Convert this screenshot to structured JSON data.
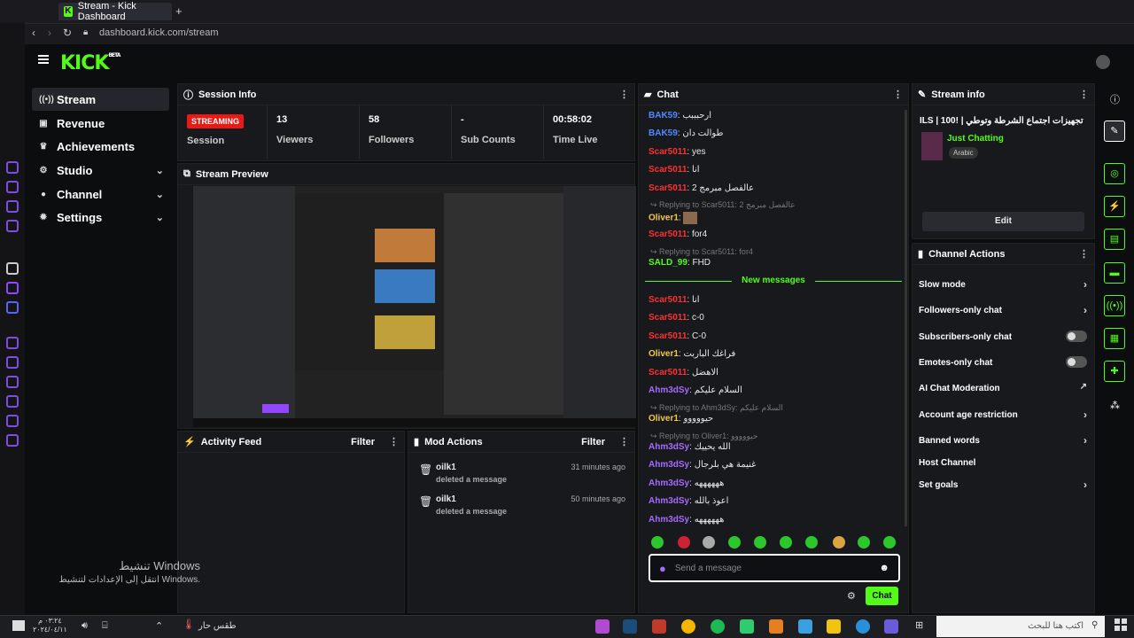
{
  "browser": {
    "tab_title": "Stream - Kick Dashboard",
    "url": "dashboard.kick.com/stream"
  },
  "app": {
    "logo": "KICK",
    "beta": "BETA"
  },
  "sidebar": {
    "items": [
      {
        "label": "Stream",
        "icon": "live-icon",
        "active": true
      },
      {
        "label": "Revenue",
        "icon": "wallet-icon"
      },
      {
        "label": "Achievements",
        "icon": "trophy-icon"
      },
      {
        "label": "Studio",
        "icon": "gear-icon",
        "expandable": true
      },
      {
        "label": "Channel",
        "icon": "user-icon",
        "expandable": true
      },
      {
        "label": "Settings",
        "icon": "settings-icon",
        "expandable": true
      }
    ]
  },
  "session": {
    "title": "Session Info",
    "badge": "STREAMING",
    "session_label": "Session",
    "stats": [
      {
        "value": "13",
        "label": "Viewers"
      },
      {
        "value": "58",
        "label": "Followers"
      },
      {
        "value": "-",
        "label": "Sub Counts"
      },
      {
        "value": "00:58:02",
        "label": "Time Live"
      }
    ]
  },
  "preview": {
    "title": "Stream Preview"
  },
  "activity": {
    "title": "Activity Feed",
    "filter": "Filter"
  },
  "mod": {
    "title": "Mod Actions",
    "filter": "Filter",
    "items": [
      {
        "user": "oilk1",
        "action": "deleted a message",
        "time": "31 minutes ago"
      },
      {
        "user": "oilk1",
        "action": "deleted a message",
        "time": "50 minutes ago"
      }
    ]
  },
  "chat": {
    "title": "Chat",
    "new_messages": "New messages",
    "placeholder": "Send a message",
    "send": "Chat",
    "messages": [
      {
        "user": "BAK59",
        "text": "ارحبببب",
        "color": "blue"
      },
      {
        "user": "BAK59",
        "text": "طوالت دان",
        "color": "blue"
      },
      {
        "user": "Scar5011",
        "text": "yes",
        "color": "red"
      },
      {
        "user": "Scar5011",
        "text": "انا",
        "color": "red"
      },
      {
        "user": "Scar5011",
        "text": "عالفصل مبرمج 2",
        "color": "red"
      },
      {
        "reply": "Replying to Scar5011: عالفصل مبرمج 2"
      },
      {
        "user": "Oliver1",
        "text": "",
        "color": "yellow"
      },
      {
        "user": "Scar5011",
        "text": "for4",
        "color": "red"
      },
      {
        "reply": "Replying to Scar5011: for4"
      },
      {
        "user": "SALD_99",
        "text": "FHD",
        "color": "green"
      },
      {
        "divider": true
      },
      {
        "user": "Scar5011",
        "text": "انا",
        "color": "red"
      },
      {
        "user": "Scar5011",
        "text": "c-0",
        "color": "red"
      },
      {
        "user": "Scar5011",
        "text": "C-0",
        "color": "red"
      },
      {
        "user": "Oliver1",
        "text": "فراغك الباربت",
        "color": "yellow"
      },
      {
        "user": "Scar5011",
        "text": "الاهضل",
        "color": "red"
      },
      {
        "user": "Ahm3dSy",
        "text": "السلام عليكم",
        "color": "purple"
      },
      {
        "reply": "Replying to Ahm3dSy: السلام عليكم"
      },
      {
        "user": "Oliver1",
        "text": "حيووووو",
        "color": "yellow"
      },
      {
        "reply": "Replying to Oliver1: حيووووو"
      },
      {
        "user": "Ahm3dSy",
        "text": "الله يحييك",
        "color": "purple"
      },
      {
        "user": "Ahm3dSy",
        "text": "غنيمة هي بلرجال",
        "color": "purple"
      },
      {
        "user": "Ahm3dSy",
        "text": "ههههههه",
        "color": "purple"
      },
      {
        "user": "Ahm3dSy",
        "text": "اعوذ بالله",
        "color": "purple"
      },
      {
        "user": "Ahm3dSy",
        "text": "ههههههه",
        "color": "purple"
      }
    ]
  },
  "stream_info": {
    "title": "Stream info",
    "stream_title": "تجهيزات اجتماع الشرطة وتوطي | !ILS | 100",
    "category": "Just Chatting",
    "tag": "Arabic",
    "edit": "Edit"
  },
  "channel_actions": {
    "title": "Channel Actions",
    "items": [
      {
        "label": "Slow mode",
        "control": "chevron"
      },
      {
        "label": "Followers-only chat",
        "control": "chevron"
      },
      {
        "label": "Subscribers-only chat",
        "control": "toggle"
      },
      {
        "label": "Emotes-only chat",
        "control": "toggle"
      },
      {
        "label": "AI Chat Moderation",
        "control": "external"
      },
      {
        "label": "Account age restriction",
        "control": "chevron"
      },
      {
        "label": "Banned words",
        "control": "chevron"
      },
      {
        "label": "Host Channel",
        "control": "none"
      },
      {
        "label": "Set goals",
        "control": "chevron"
      }
    ]
  },
  "watermark": {
    "line1": "تنشيط Windows",
    "line2": "انتقل إلى الإعدادات لتنشيط Windows."
  },
  "taskbar": {
    "weather": "طقس حار",
    "search": "اكتب هنا للبحث",
    "time": "٠٣:٢٤ م",
    "date": "٢٠٢٤/٠٤/١١"
  },
  "colors": {
    "accent": "#53fc18",
    "live": "#e91916"
  }
}
